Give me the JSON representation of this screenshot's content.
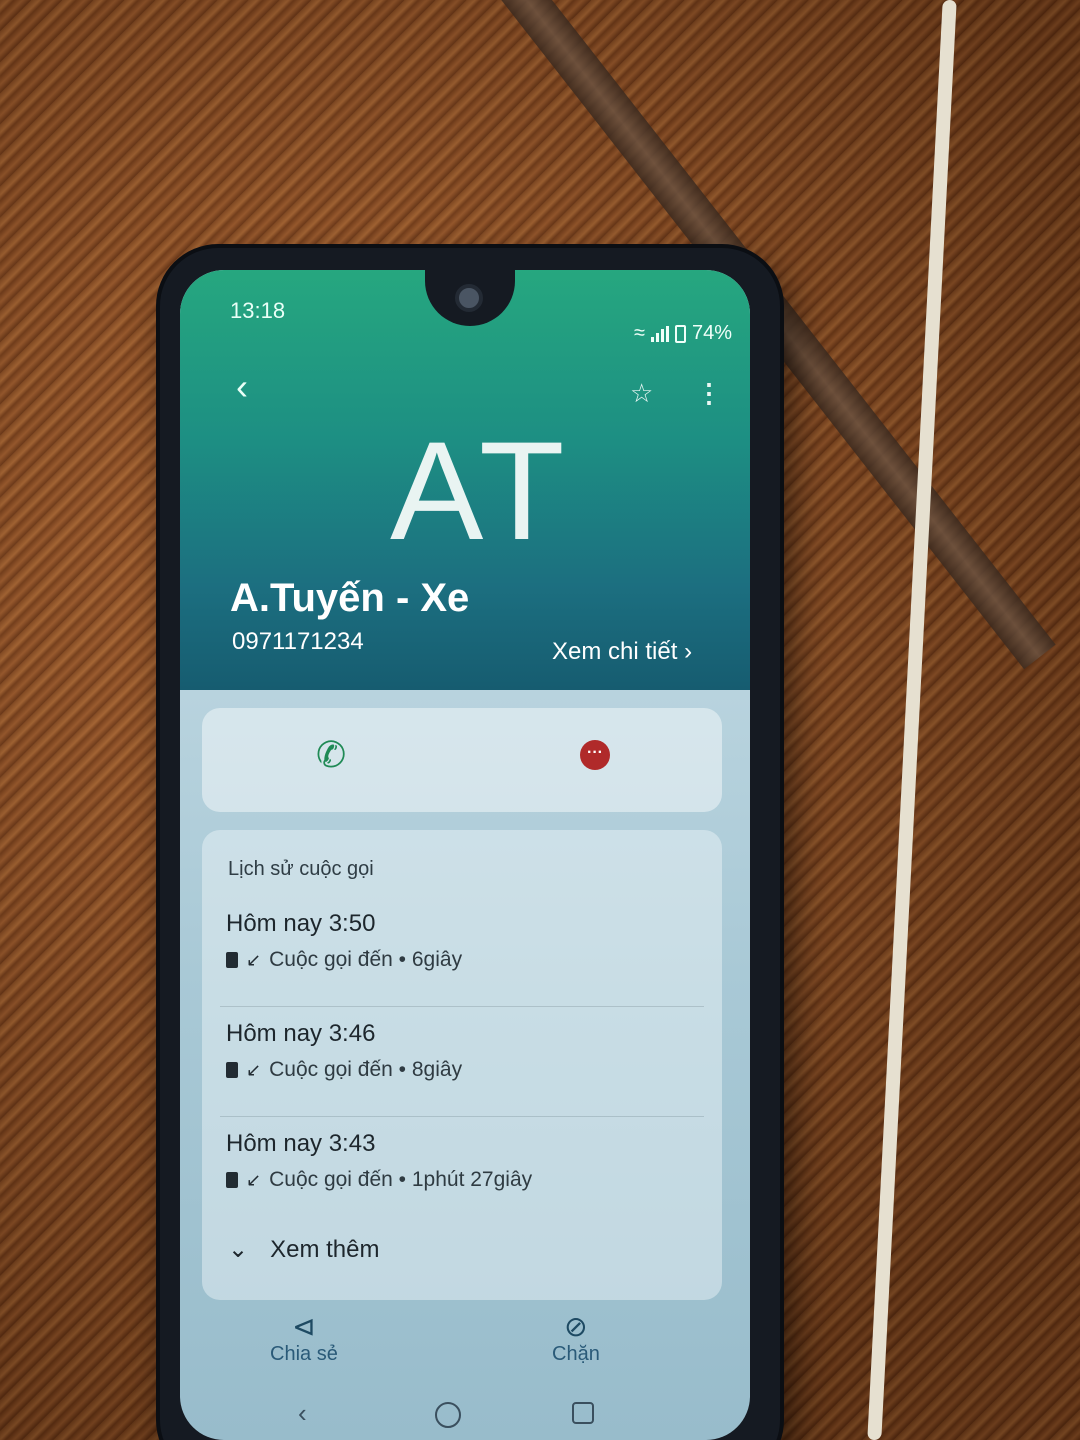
{
  "status_bar": {
    "time": "13:18",
    "battery": "74%"
  },
  "contact": {
    "initials": "AT",
    "name": "A.Tuyến - Xe",
    "phone": "0971171234",
    "details_label": "Xem chi tiết"
  },
  "history": {
    "title": "Lịch sử cuộc gọi",
    "calls": [
      {
        "time": "Hôm nay 3:50",
        "description": "Cuộc gọi đến • 6giây"
      },
      {
        "time": "Hôm nay 3:46",
        "description": "Cuộc gọi đến • 8giây"
      },
      {
        "time": "Hôm nay 3:43",
        "description": "Cuộc gọi đến • 1phút 27giây"
      }
    ],
    "see_more": "Xem thêm"
  },
  "bottom_actions": {
    "share": "Chia sẻ",
    "block": "Chặn"
  },
  "colors": {
    "header_top": "#26a77f",
    "header_bottom": "#165c70",
    "call_icon": "#1f8a55",
    "message_icon": "#b02a2a"
  },
  "icons": [
    "back-icon",
    "star-icon",
    "more-icon",
    "phone-icon",
    "message-icon",
    "sim-icon",
    "incoming-arrow-icon",
    "chevron-down-icon",
    "share-icon",
    "block-icon",
    "nav-back-icon",
    "nav-home-icon",
    "nav-recent-icon"
  ]
}
